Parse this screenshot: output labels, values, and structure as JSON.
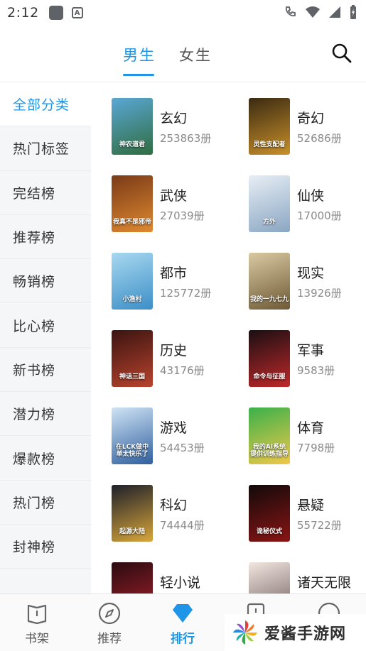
{
  "status_bar": {
    "time": "2:12",
    "notification_glyph": "A"
  },
  "tabs": [
    {
      "label": "男生",
      "active": true
    },
    {
      "label": "女生",
      "active": false
    }
  ],
  "side_menu": [
    {
      "label": "全部分类",
      "active": true
    },
    {
      "label": "热门标签"
    },
    {
      "label": "完结榜"
    },
    {
      "label": "推荐榜"
    },
    {
      "label": "畅销榜"
    },
    {
      "label": "比心榜"
    },
    {
      "label": "新书榜"
    },
    {
      "label": "潜力榜"
    },
    {
      "label": "爆款榜"
    },
    {
      "label": "热门榜"
    },
    {
      "label": "封神榜"
    }
  ],
  "categories": [
    {
      "name": "玄幻",
      "count": "253863册",
      "cover_text": "神农道君",
      "colors": [
        "#5aa7d6",
        "#2f6d3f"
      ]
    },
    {
      "name": "奇幻",
      "count": "52686册",
      "cover_text": "灵性支配者",
      "colors": [
        "#3a2a12",
        "#c9902a"
      ]
    },
    {
      "name": "武侠",
      "count": "27039册",
      "cover_text": "我真不是邪帝",
      "colors": [
        "#7a3a18",
        "#e08a30"
      ]
    },
    {
      "name": "仙侠",
      "count": "17000册",
      "cover_text": "方外",
      "colors": [
        "#e7eef5",
        "#8aa6c2"
      ]
    },
    {
      "name": "都市",
      "count": "125772册",
      "cover_text": "小渔村",
      "colors": [
        "#a8d8f0",
        "#3c8fc7"
      ]
    },
    {
      "name": "现实",
      "count": "13926册",
      "cover_text": "我的一九七九",
      "colors": [
        "#d9c9a2",
        "#6e5a36"
      ]
    },
    {
      "name": "历史",
      "count": "43176册",
      "cover_text": "神话三国",
      "colors": [
        "#3b1410",
        "#b8432e"
      ]
    },
    {
      "name": "军事",
      "count": "9583册",
      "cover_text": "命令与征服",
      "colors": [
        "#1a0f12",
        "#c0282a"
      ]
    },
    {
      "name": "游戏",
      "count": "54453册",
      "cover_text": "在LCK做中单太快乐了",
      "colors": [
        "#cfe4f5",
        "#2f5f9e"
      ]
    },
    {
      "name": "体育",
      "count": "7798册",
      "cover_text": "我的AI系统提供训练指导",
      "colors": [
        "#3ab14a",
        "#f0c84a"
      ]
    },
    {
      "name": "科幻",
      "count": "74444册",
      "cover_text": "起源大陆",
      "colors": [
        "#1d1f2a",
        "#d9a63a"
      ]
    },
    {
      "name": "悬疑",
      "count": "55722册",
      "cover_text": "诡秘仪式",
      "colors": [
        "#120a0a",
        "#8a1414"
      ]
    },
    {
      "name": "轻小说",
      "count": "",
      "cover_text": "",
      "colors": [
        "#2a0c10",
        "#a8202c"
      ]
    },
    {
      "name": "诸天无限",
      "count": "",
      "cover_text": "",
      "colors": [
        "#f2e6e0",
        "#6b5a5a"
      ]
    }
  ],
  "bottom_nav": [
    {
      "label": "书架",
      "icon": "book-icon",
      "active": false
    },
    {
      "label": "推荐",
      "icon": "compass-icon",
      "active": false
    },
    {
      "label": "排行",
      "icon": "diamond-icon",
      "active": true
    },
    {
      "label": "",
      "icon": "partial-icon",
      "active": false
    },
    {
      "label": "",
      "icon": "partial-icon",
      "active": false
    }
  ],
  "watermark": {
    "text": "爱酱手游网"
  },
  "colors": {
    "accent": "#1e95e6"
  }
}
